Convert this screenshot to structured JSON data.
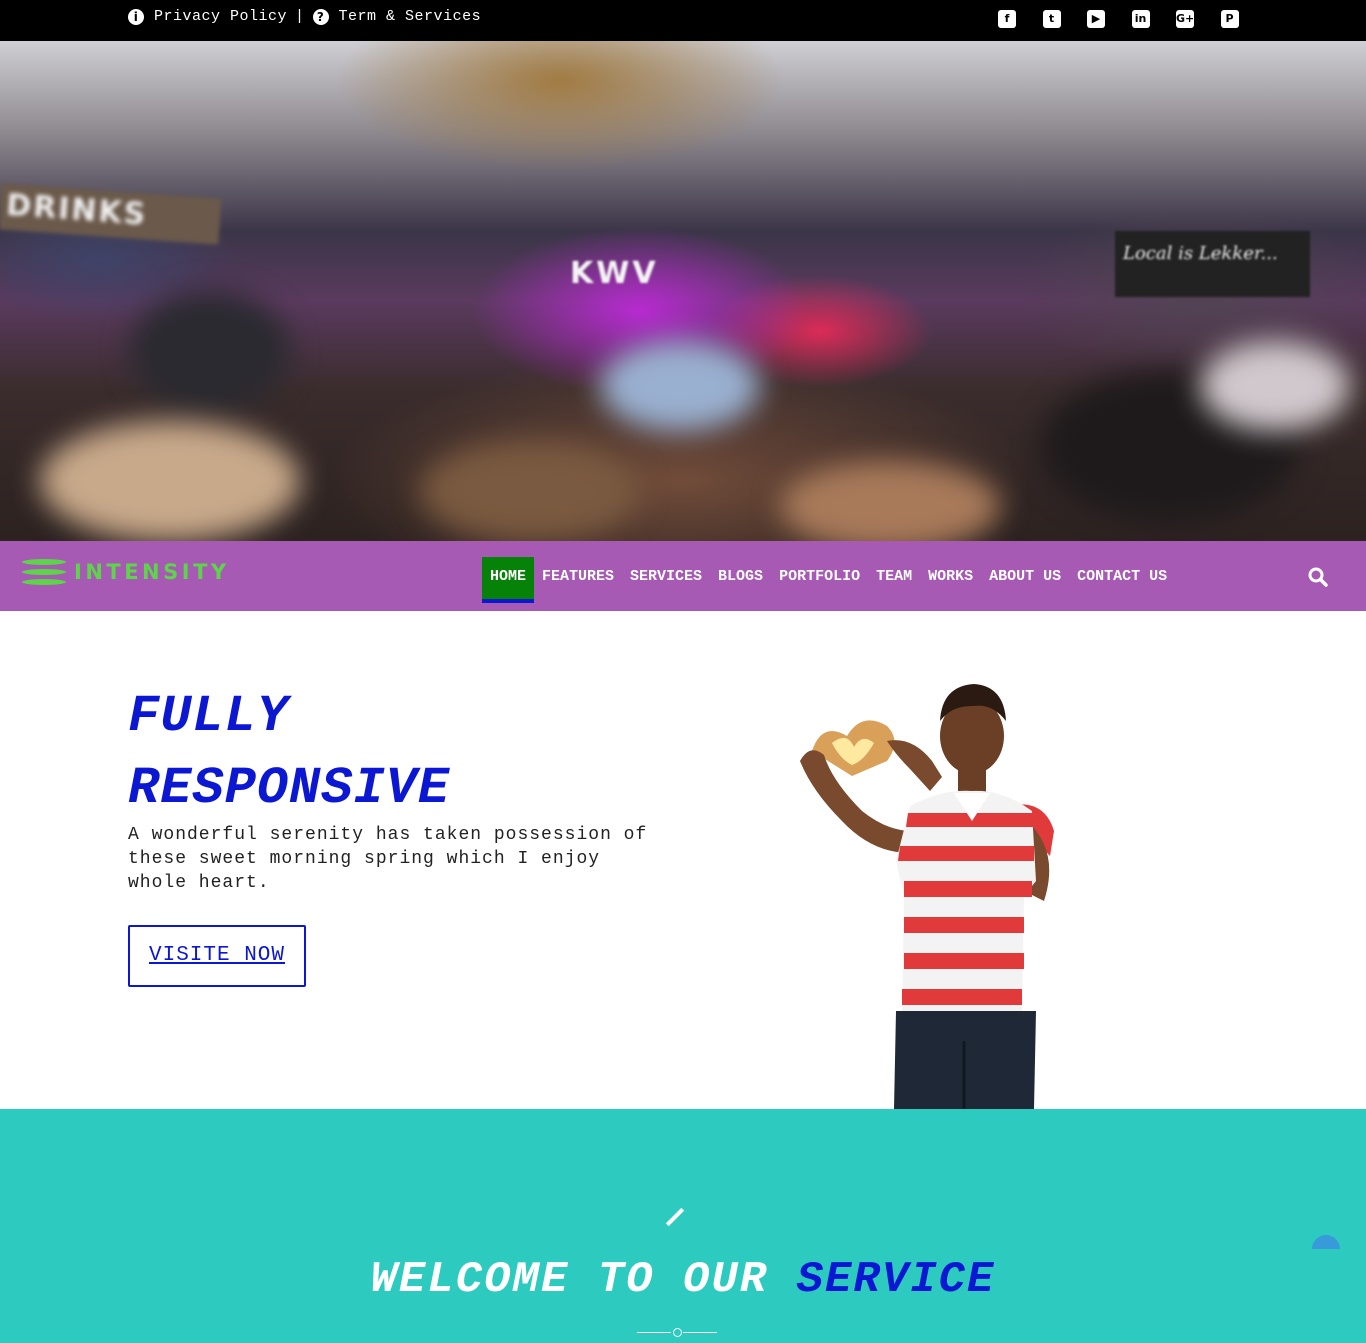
{
  "topbar": {
    "privacy_label": "Privacy Policy",
    "separator": "|",
    "terms_label": "Term & Services",
    "info_icon_glyph": "i",
    "help_icon_glyph": "?",
    "social": [
      {
        "name": "facebook-icon",
        "glyph": "f"
      },
      {
        "name": "twitter-icon",
        "glyph": "t"
      },
      {
        "name": "youtube-icon",
        "glyph": "▶"
      },
      {
        "name": "linkedin-icon",
        "glyph": "in"
      },
      {
        "name": "google-plus-icon",
        "glyph": "G+"
      },
      {
        "name": "pinterest-icon",
        "glyph": "P"
      }
    ]
  },
  "hero": {
    "sign_text": "DRINKS",
    "stage_text": "KWV",
    "board_text": "Local is Lekker..."
  },
  "nav": {
    "logo_text": "INTENSITY",
    "items": [
      {
        "label": "HOME",
        "active": true
      },
      {
        "label": "FEATURES"
      },
      {
        "label": "SERVICES"
      },
      {
        "label": "BLOGS"
      },
      {
        "label": "PORTFOLIO"
      },
      {
        "label": "TEAM"
      },
      {
        "label": "WORKS"
      },
      {
        "label": "ABOUT US"
      },
      {
        "label": "CONTACT US"
      }
    ]
  },
  "banner": {
    "title_line1": "FULLY",
    "title_line2": "RESPONSIVE",
    "description": "A wonderful serenity has taken possession of these sweet morning spring which I enjoy whole heart.",
    "button_label": "VISITE NOW"
  },
  "service": {
    "title_plain": "WELCOME TO OUR",
    "title_highlight": "SERVICE"
  },
  "colors": {
    "brand_blue": "#0b17d1",
    "nav_bg": "#a65ab3",
    "active_green": "#078209",
    "logo_green": "#5ed44a",
    "service_bg": "#2dcbbf"
  }
}
